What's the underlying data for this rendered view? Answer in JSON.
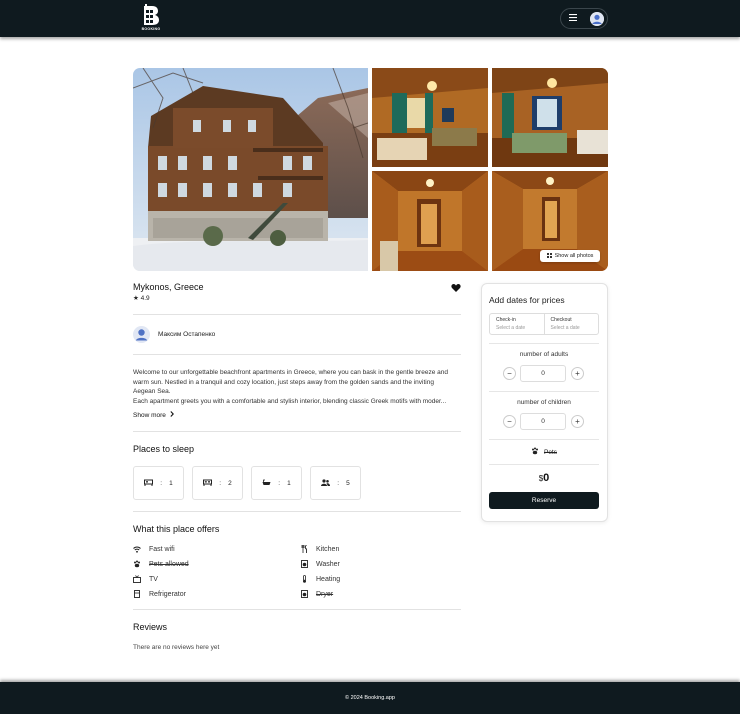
{
  "header": {
    "logo_text": "BOOKING"
  },
  "gallery": {
    "show_all_label": "Show all photos"
  },
  "listing": {
    "title": "Mykonos, Greece",
    "rating": "4.9",
    "host_name": "Максим Остапенко",
    "description": [
      "Welcome to our unforgettable beachfront apartments in Greece, where you can bask in the gentle breeze and",
      "warm sun. Nestled in a tranquil and cozy location, just steps away from the golden sands and the inviting",
      "Aegean Sea.",
      "Each apartment greets you with a comfortable and stylish interior, blending classic Greek motifs with moder..."
    ],
    "show_more_label": "Show more"
  },
  "sleep": {
    "title": "Places to sleep",
    "items": [
      {
        "icon": "bed-icon",
        "separator": ":",
        "value": "1"
      },
      {
        "icon": "double-bed-icon",
        "separator": ":",
        "value": "2"
      },
      {
        "icon": "bathtub-icon",
        "separator": ":",
        "value": "1"
      },
      {
        "icon": "guests-icon",
        "separator": ":",
        "value": "5"
      }
    ]
  },
  "offers": {
    "title": "What this place offers",
    "left": [
      {
        "icon": "wifi-icon",
        "label": "Fast wifi",
        "unavailable": false
      },
      {
        "icon": "paw-icon",
        "label": "Pets allowed",
        "unavailable": true
      },
      {
        "icon": "tv-icon",
        "label": "TV",
        "unavailable": false
      },
      {
        "icon": "fridge-icon",
        "label": "Refrigerator",
        "unavailable": false
      }
    ],
    "right": [
      {
        "icon": "kitchen-icon",
        "label": "Kitchen",
        "unavailable": false
      },
      {
        "icon": "washer-icon",
        "label": "Washer",
        "unavailable": false
      },
      {
        "icon": "thermometer-icon",
        "label": "Heating",
        "unavailable": false
      },
      {
        "icon": "dryer-icon",
        "label": "Dryer",
        "unavailable": true
      }
    ]
  },
  "reviews": {
    "title": "Reviews",
    "empty_text": "There are no reviews here yet"
  },
  "booking": {
    "title": "Add dates for prices",
    "checkin_label": "Check-in",
    "checkin_placeholder": "Select a date",
    "checkout_label": "Checkout",
    "checkout_placeholder": "Select a date",
    "adults_label": "number of adults",
    "adults_value": "0",
    "children_label": "number of children",
    "children_value": "0",
    "minus": "−",
    "plus": "+",
    "pets_label": "Pets",
    "currency": "$",
    "price": "0",
    "reserve_label": "Reserve"
  },
  "footer": {
    "copyright": "© 2024 Booking.app"
  },
  "colors": {
    "dark": "#0f1a1f",
    "divider": "#e2e2e2"
  }
}
